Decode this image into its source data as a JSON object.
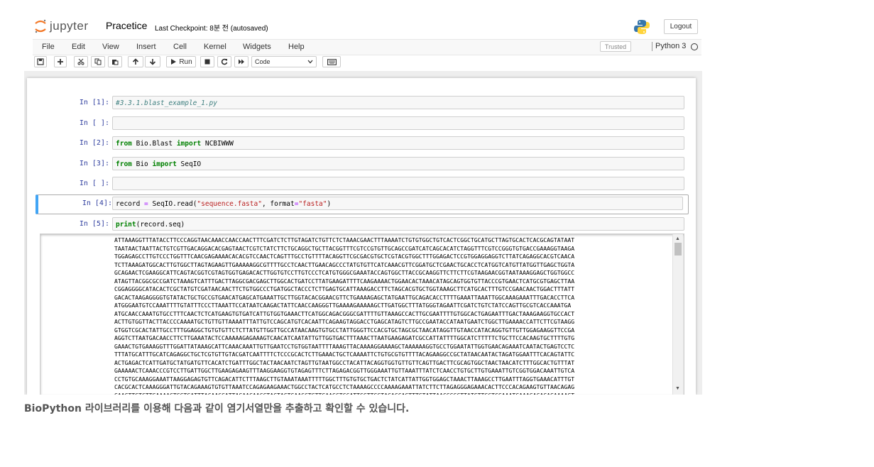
{
  "header": {
    "logo_text": "jupyter",
    "notebook_name": "Pracetice",
    "checkpoint": "Last Checkpoint: 8분 전   (autosaved)",
    "logout_label": "Logout"
  },
  "menu": [
    "File",
    "Edit",
    "View",
    "Insert",
    "Cell",
    "Kernel",
    "Widgets",
    "Help"
  ],
  "status": {
    "trusted": "Trusted",
    "kernel": "Python 3"
  },
  "toolbar": {
    "run_label": "Run",
    "cell_type": "Code"
  },
  "cells": [
    {
      "prompt": "In [1]:",
      "code": "#3.3.1.blast_example_1.py"
    },
    {
      "prompt": "In [ ]:",
      "code": ""
    },
    {
      "prompt": "In [2]:",
      "code": "from Bio.Blast import NCBIWWW"
    },
    {
      "prompt": "In [3]:",
      "code": "from Bio import SeqIO"
    },
    {
      "prompt": "In [ ]:",
      "code": ""
    },
    {
      "prompt": "In [4]:",
      "code": "record = SeqIO.read(\"sequence.fasta\", format=\"fasta\")"
    },
    {
      "prompt": "In [5]:",
      "code": "print(record.seq)"
    }
  ],
  "output_lines": [
    "ATTAAAGGTTTATACCTTCCCAGGTAACAAACCAACCAACTTTCGATCTCTTGTAGATCTGTTCTCTAAACGAACTTTAAAATCTGTGTGGCTGTCACTCGGCTGCATGCTTAGTGCACTCACGCAGTATAAT",
    "TAATAACTAATTACTGTCGTTGACAGGACACGAGTAACTCGTCTATCTTCTGCAGGCTGCTTACGGTTTCGTCCGTGTTGCAGCCGATCATCAGCACATCTAGGTTTCGTCCGGGTGTGACCGAAAGGTAAGA",
    "TGGAGAGCCTTGTCCCTGGTTTCAACGAGAAAACACACGTCCAACTCAGTTTGCCTGTTTTACAGGTTCGCGACGTGCTCGTACGTGGCTTTGGAGACTCCGTGGAGGAGGTCTTATCAGAGGCACGTCAACA",
    "TCTTAAAGATGGCACTTGTGGCTTAGTAGAAGTTGAAAAAGGCGTTTTGCCTCAACTTGAACAGCCCTATGTGTTCATCAAACGTTCGGATGCTCGAACTGCACCTCATGGTCATGTTATGGTTGAGCTGGTA",
    "GCAGAACTCGAAGGCATTCAGTACGGTCGTAGTGGTGAGACACTTGGTGTCCTTGTCCCTCATGTGGGCGAAATACCAGTGGCTTACCGCAAGGTTCTTCTTCGTAAGAACGGTAATAAAGGAGCTGGTGGCC",
    "ATAGTTACGGCGCCGATCTAAAGTCATTTGACTTAGGCGACGAGCTTGGCACTGATCCTTATGAAGATTTTCAAGAAAACTGGAACACTAAACATAGCAGTGGTGTTACCCGTGAACTCATGCGTGAGCTTAA",
    "CGGAGGGGCATACACTCGCTATGTCGATAACAACTTCTGTGGCCCTGATGGCTACCCTCTTGAGTGCATTAAAGACCTTCTAGCACGTGCTGGTAAAGCTTCATGCACTTTGTCCGAACAACTGGACTTTATT",
    "GACACTAAGAGGGGTGTATACTGCTGCCGTGAACATGAGCATGAAATTGCTTGGTACACGGAACGTTCTGAAAAGAGCTATGAATTGCAGACACCTTTTGAAATTAAATTGGCAAAGAAATTTGACACCTTCA",
    "ATGGGAATGTCCAAATTTTGTATTTCCCTTAAATTCCATAATCAAGACTATTCAACCAAGGGTTGAAAAGAAAAAGCTTGATGGCTTTATGGGTAGAATTCGATCTGTCTATCCAGTTGCGTCACCAAATGA",
    "ATGCAACCAAATGTGCCTTTCAACTCTCATGAAGTGTGATCATTGTGGTGAAACTTCATGGCAGACGGGCGATTTTGTTAAAGCCACTTGCGAATTTTGTGGCACTGAGAATTTGACTAAAGAAGGTGCCACT",
    "ACTTGTGGTTACTTACCCCAAAATGCTGTTGTTAAAATTTATTGTCCAGCATGTCACAATTCAGAAGTAGGACCTGAGCATAGTCTTGCCGAATACCATAATGAATCTGGCTTGAAAACCATTCTTCGTAAGG",
    "GTGGTCGCACTATTGCCTTTGGAGGCTGTGTGTTCTCTTATGTTGGTTGCCATAACAAGTGTGCCTATTGGGTTCCACGTGCTAGCGCTAACATAGGTTGTAACCATACAGGTGTTGTTGGAGAAGGTTCCGA",
    "AGGTCTTAATGACAACCTTCTTGAAATACTCCAAAAAGAGAAAGTCAACATCAATATTGTTGGTGACTTTAAACTTAATGAAGAGATCGCCATTATTTTGGCATCTTTTTCTGCTTCCACAAGTGCTTTTGTG",
    "GAAACTGTGAAAGGTTTGGATTATAAAGCATTCAAACAAATTGTTGAATCCTGTGGTAATTTTAAAGTTACAAAAGGAAAAGCTAAAAAAGGTGCCTGGAATATTGGTGAACAGAAATCAATACTGAGTCCTC",
    "TTTATGCATTTGCATCAGAGGCTGCTCGTGTTGTACGATCAATTTTCTCCCGCACTCTTGAAACTGCTCAAAATTCTGTGCGTGTTTTACAGAAGGCCGCTATAACAATACTAGATGGAATTTCACAGTATTC",
    "ACTGAGACTCATTGATGCTATGATGTTCACATCTGATTTGGCTACTAACAATCTAGTTGTAATGGCCTACATTACAGGTGGTGTTGTTCAGTTGACTTCGCAGTGGCTAACTAACATCTTTGGCACTGTTTAT",
    "GAAAAACTCAAACCCGTCCTTGATTGGCTTGAAGAGAAGTTTAAGGAAGGTGTAGAGTTTCTTAGAGACGGTTGGGAAATTGTTAAATTTATCTCAACCTGTGCTTGTGAAATTGTCGGTGGACAAATTGTCA",
    "CCTGTGCAAAGGAAATTAAGGAGAGTGTTCAGACATTCTTTAAGCTTGTAAATAAATTTTTGGCTTTGTGTGCTGACTCTATCATTATTGGTGGAGCTAAACTTAAAGCCTTGAATTTAGGTGAAACATTTGT",
    "CACGCACTCAAAGGGATTGTACAGAAAGTGTGTTAAATCCAGAGAAGAAACTGGCCTACTCATGCCTCTAAAAGCCCCAAAAGAAATTATCTTCTTAGAGGGAGAAACACTTCCCACAGAAGTGTTAACAGAG",
    "GAAGTTGTCTTGAAAACTGGTGATTTACAACCATTAGAACAACCTACTAGTGAAGCTGTTGAAGCTCCATTGGTTGGTACACCAGTTTGTATTAACGGGCTTATGTTGCTCGAAATCAAAGACACAGAAAAGT"
  ],
  "caption": "BioPython  라이브러리를 이용해 다음과 같이 염기서열만을 추출하고 확인할 수 있습니다."
}
